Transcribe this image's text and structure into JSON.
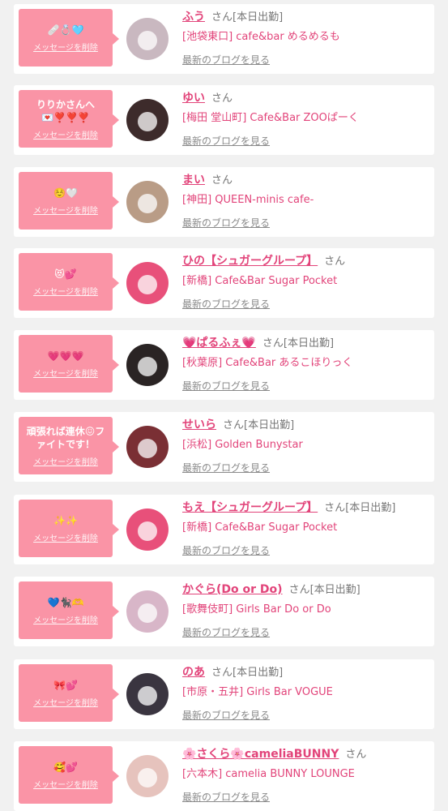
{
  "cards": [
    {
      "message": "🩹💍🩵",
      "delete_label": "メッセージを削除",
      "name": "ふう",
      "san": "さん",
      "status": "[本日出勤]",
      "shop": "[池袋東口] cafe&bar めるめるも",
      "blog_link": "最新のブログを見る",
      "avatar_color": "#c9b8c0"
    },
    {
      "message": "りりかさんへ💌❣️❣️❣️",
      "delete_label": "メッセージを削除",
      "name": "ゆい",
      "san": "さん",
      "status": "",
      "shop": "[梅田 堂山町] Cafe&Bar ZOOぱーく",
      "blog_link": "最新のブログを見る",
      "avatar_color": "#3d2b2b"
    },
    {
      "message": "☺️🤍",
      "delete_label": "メッセージを削除",
      "name": "まい",
      "san": "さん",
      "status": "",
      "shop": "[神田] QUEEN-minis cafe-",
      "blog_link": "最新のブログを見る",
      "avatar_color": "#b99c86"
    },
    {
      "message": "😻💕",
      "delete_label": "メッセージを削除",
      "name": "ひの【シュガーグループ】",
      "san": "さん",
      "status": "",
      "shop": "[新橋] Cafe&Bar Sugar Pocket",
      "blog_link": "最新のブログを見る",
      "avatar_color": "#e8507a"
    },
    {
      "message": "💗💗💗",
      "delete_label": "メッセージを削除",
      "name": "💗ぱるふぇ💗",
      "san": "さん",
      "status": "[本日出勤]",
      "shop": "[秋葉原] Cafe&Bar あるこほりっく",
      "blog_link": "最新のブログを見る",
      "avatar_color": "#2a2424"
    },
    {
      "message": "頑張れば連休😖ファイトです！",
      "delete_label": "メッセージを削除",
      "name": "せいら",
      "san": "さん",
      "status": "[本日出勤]",
      "shop": "[浜松] Golden Bunystar",
      "blog_link": "最新のブログを見る",
      "avatar_color": "#7a2f34"
    },
    {
      "message": "✨✨",
      "delete_label": "メッセージを削除",
      "name": "もえ【シュガーグループ】",
      "san": "さん",
      "status": "[本日出勤]",
      "shop": "[新橋] Cafe&Bar Sugar Pocket",
      "blog_link": "最新のブログを見る",
      "avatar_color": "#e8507a"
    },
    {
      "message": "💙🐈‍⬛🫶",
      "delete_label": "メッセージを削除",
      "name": "かぐら(Do or Do)",
      "san": "さん",
      "status": "[本日出勤]",
      "shop": "[歌舞伎町] Girls Bar Do or Do",
      "blog_link": "最新のブログを見る",
      "avatar_color": "#d8b6c8"
    },
    {
      "message": "🎀💕",
      "delete_label": "メッセージを削除",
      "name": "のあ",
      "san": "さん",
      "status": "[本日出勤]",
      "shop": "[市原・五井] Girls Bar VOGUE",
      "blog_link": "最新のブログを見る",
      "avatar_color": "#3a3540"
    },
    {
      "message": "🥰💕",
      "delete_label": "メッセージを削除",
      "name": "🌸さくら🌸cameliaBUNNY",
      "san": "さん",
      "status": "",
      "shop": "[六本木] camelia BUNNY LOUNGE",
      "blog_link": "最新のブログを見る",
      "avatar_color": "#e6c3bd"
    }
  ]
}
